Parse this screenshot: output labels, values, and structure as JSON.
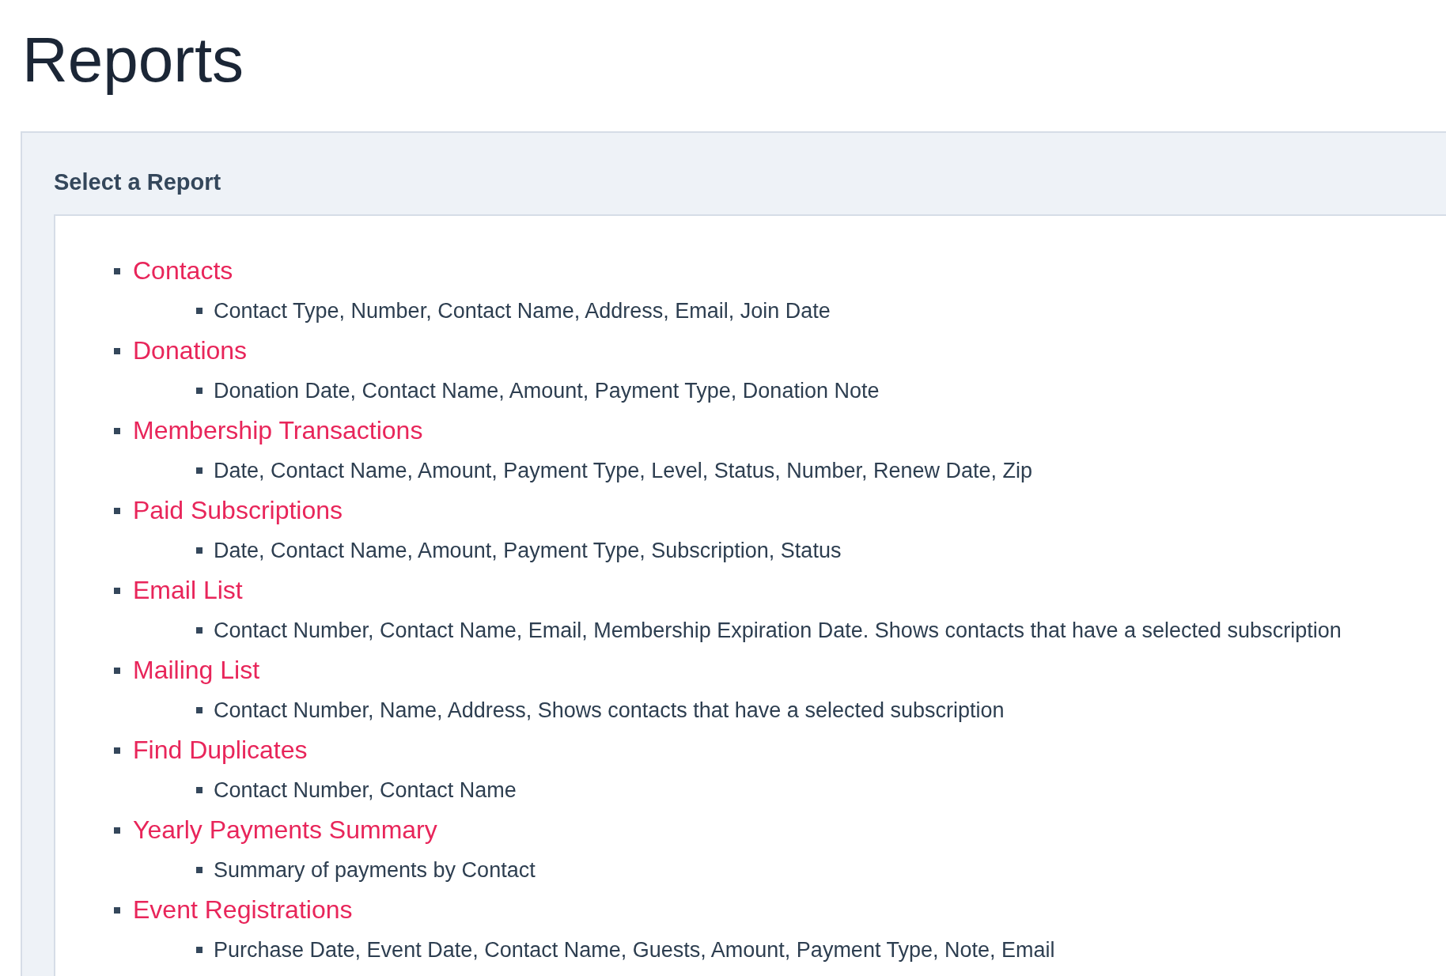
{
  "title": "Reports",
  "panel": {
    "heading": "Select a Report",
    "reports": [
      {
        "name": "Contacts",
        "description": "Contact Type, Number, Contact Name, Address, Email, Join Date"
      },
      {
        "name": "Donations",
        "description": "Donation Date, Contact Name, Amount, Payment Type, Donation Note"
      },
      {
        "name": "Membership Transactions",
        "description": "Date, Contact Name, Amount, Payment Type, Level, Status, Number, Renew Date, Zip"
      },
      {
        "name": "Paid Subscriptions",
        "description": "Date, Contact Name, Amount, Payment Type, Subscription, Status"
      },
      {
        "name": "Email List",
        "description": "Contact Number, Contact Name, Email, Membership Expiration Date. Shows contacts that have a selected subscription"
      },
      {
        "name": "Mailing List",
        "description": "Contact Number, Name, Address, Shows contacts that have a selected subscription"
      },
      {
        "name": "Find Duplicates",
        "description": "Contact Number, Contact Name"
      },
      {
        "name": "Yearly Payments Summary",
        "description": "Summary of payments by Contact"
      },
      {
        "name": "Event Registrations",
        "description": "Purchase Date, Event Date, Contact Name, Guests, Amount, Payment Type, Note, Email"
      }
    ]
  }
}
